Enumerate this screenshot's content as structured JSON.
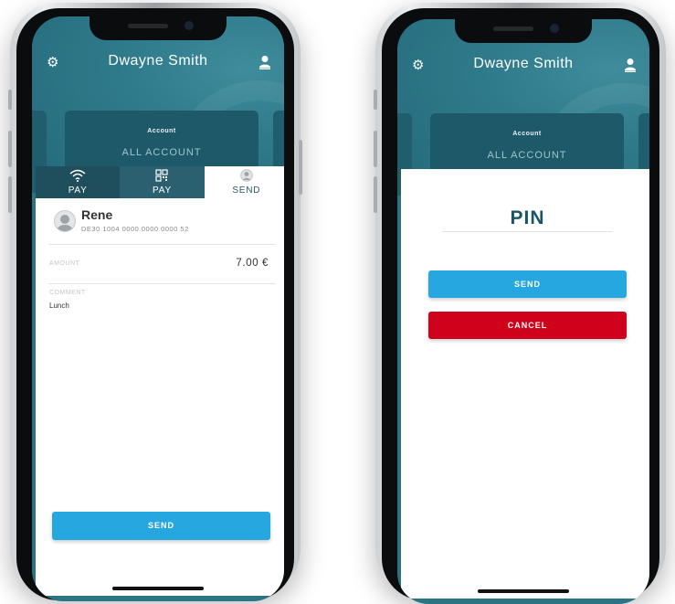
{
  "left_phone": {
    "header": {
      "title": "Dwayne Smith",
      "settings_icon": "gear-icon",
      "profile_icon": "user-icon"
    },
    "account_card": {
      "label": "Account",
      "value": "ALL ACCOUNT"
    },
    "tabs": [
      {
        "label": "PAY",
        "icon": "wifi-contactless-icon",
        "active": false
      },
      {
        "label": "PAY",
        "icon": "qr-code-icon",
        "active": false
      },
      {
        "label": "SEND",
        "icon": "person-icon",
        "active": true
      }
    ],
    "recipient": {
      "name": "Rene",
      "iban": "DE30 1004 0000 0000 0000 52"
    },
    "amount": {
      "label": "AMOUNT",
      "value": "7.00 €"
    },
    "comment": {
      "label": "COMMENT",
      "value": "Lunch"
    },
    "send_button": "SEND"
  },
  "right_phone": {
    "header": {
      "title": "Dwayne Smith",
      "settings_icon": "gear-icon",
      "profile_icon": "user-icon"
    },
    "account_card": {
      "label": "Account",
      "value": "ALL ACCOUNT"
    },
    "pin_title": "PIN",
    "send_button": "SEND",
    "cancel_button": "CANCEL"
  },
  "colors": {
    "teal_header": "#2c7484",
    "send_blue": "#27a7df",
    "cancel_red": "#d0021b",
    "pin_text": "#1a5566"
  }
}
